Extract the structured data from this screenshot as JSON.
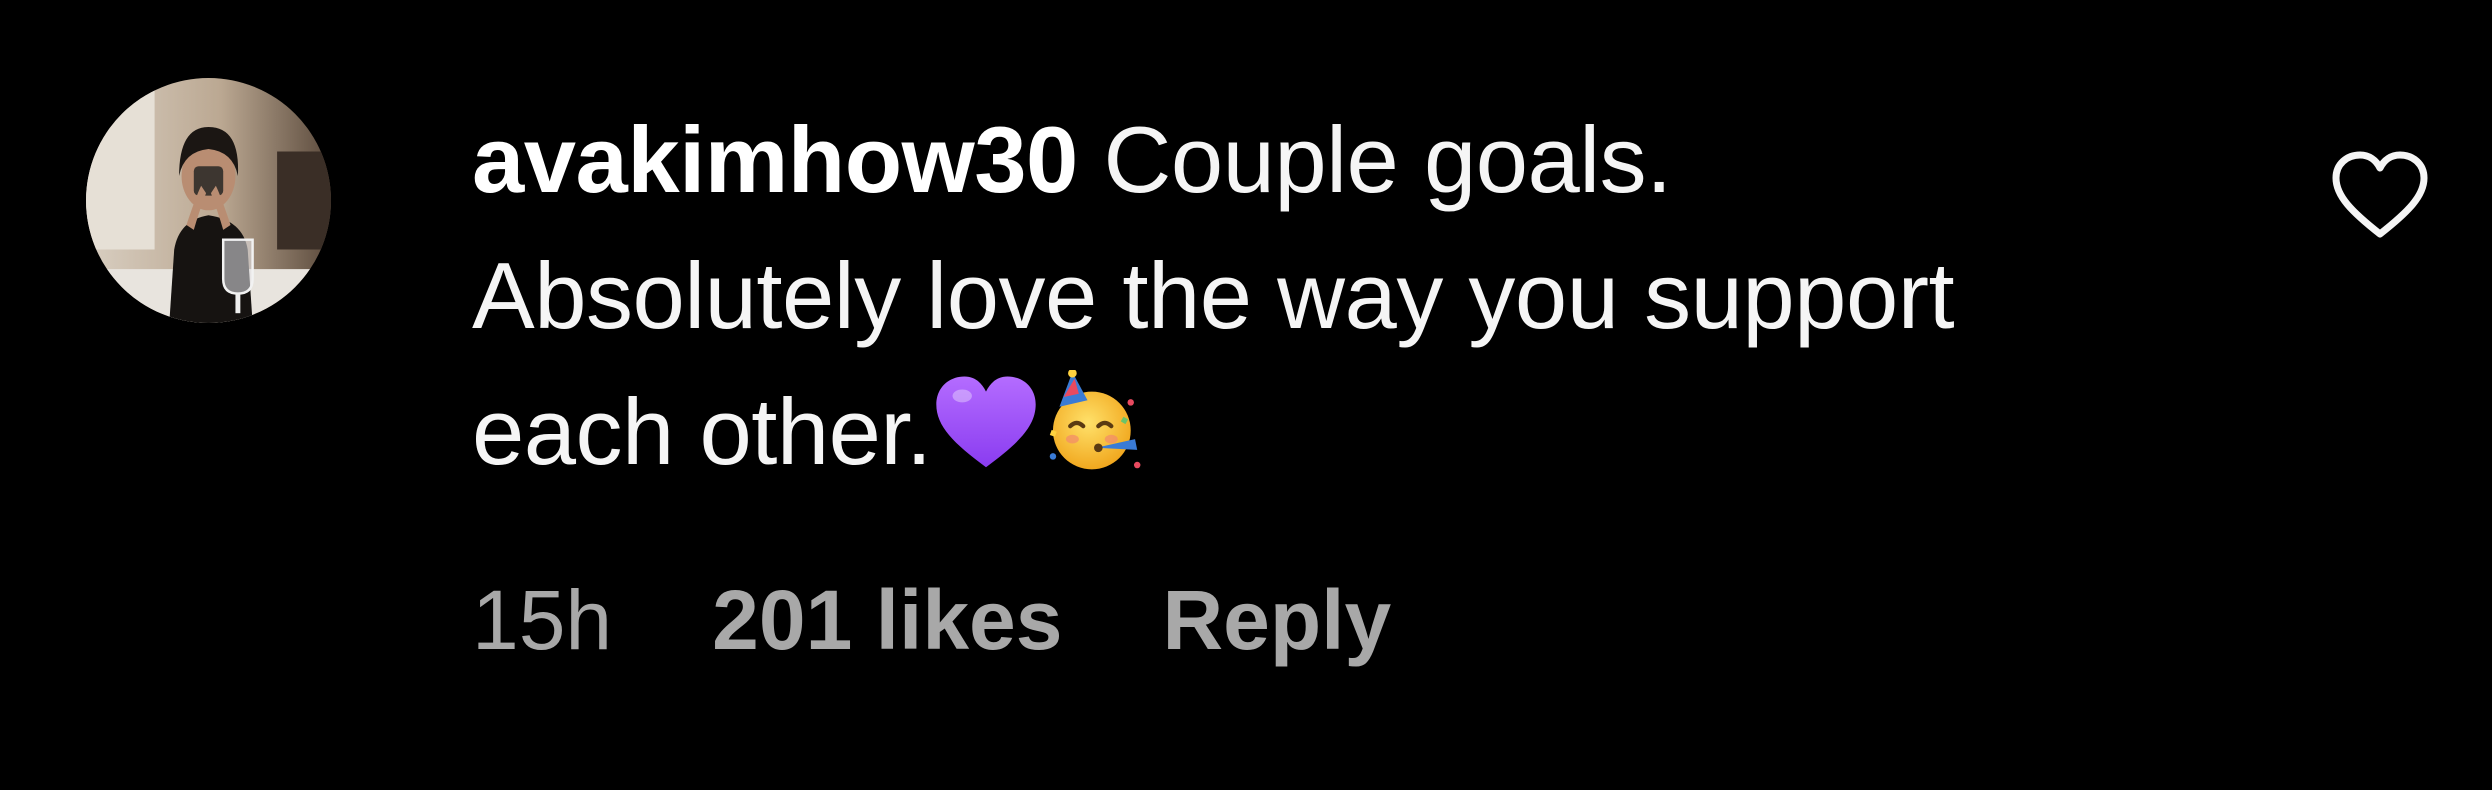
{
  "comment": {
    "username": "avakimhow30",
    "text": "Couple goals. Absolutely love the way you support each other.",
    "emojis": [
      "purple-heart-emoji",
      "partying-face-emoji"
    ],
    "avatar_icon": "user-avatar-photo"
  },
  "meta": {
    "timestamp": "15h",
    "likes": "201 likes",
    "reply_label": "Reply"
  },
  "like_icon": "heart-outline-icon",
  "colors": {
    "background": "#000000",
    "primary_text": "#f5f5f5",
    "secondary_text": "#a8a8a8",
    "purple_heart": "#9b4dff",
    "party_face": "#f7c23a"
  }
}
